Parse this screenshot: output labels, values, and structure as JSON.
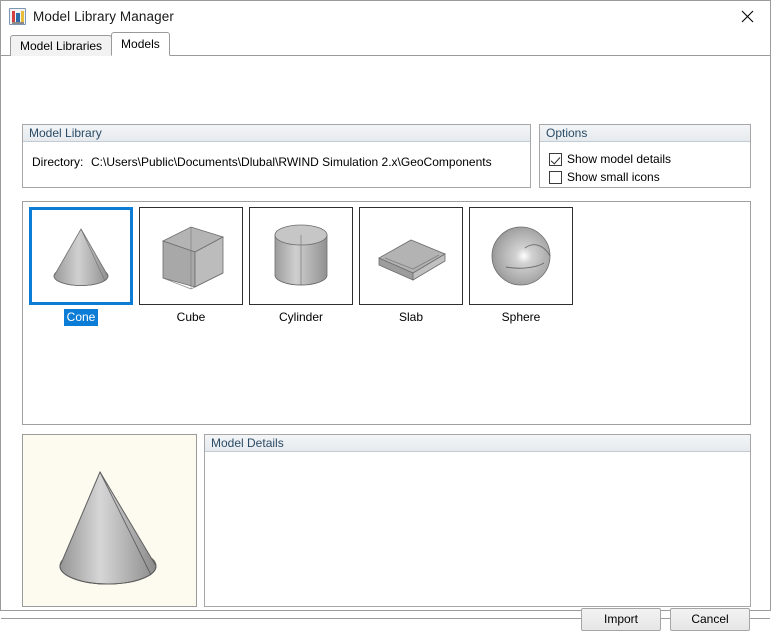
{
  "window": {
    "title": "Model Library Manager",
    "icon": "library-icon",
    "close_label": "✕"
  },
  "tabs": [
    {
      "label": "Model Libraries",
      "active": false
    },
    {
      "label": "Models",
      "active": true
    }
  ],
  "model_library": {
    "group_title": "Model Library",
    "directory_label": "Directory:",
    "directory_value": "C:\\Users\\Public\\Documents\\Dlubal\\RWIND Simulation 2.x\\GeoComponents"
  },
  "options": {
    "group_title": "Options",
    "items": [
      {
        "label": "Show model details",
        "checked": true
      },
      {
        "label": "Show small icons",
        "checked": false
      }
    ]
  },
  "models": [
    {
      "label": "Cone",
      "shape": "cone",
      "selected": true
    },
    {
      "label": "Cube",
      "shape": "cube",
      "selected": false
    },
    {
      "label": "Cylinder",
      "shape": "cylinder",
      "selected": false
    },
    {
      "label": "Slab",
      "shape": "slab",
      "selected": false
    },
    {
      "label": "Sphere",
      "shape": "sphere",
      "selected": false
    }
  ],
  "preview": {
    "shape": "cone",
    "background_color": "#fdfbef"
  },
  "model_details": {
    "group_title": "Model Details",
    "content": ""
  },
  "footer": {
    "import_label": "Import",
    "cancel_label": "Cancel"
  },
  "colors": {
    "selection_blue": "#0c7dd6",
    "group_header_text": "#2a4b66",
    "window_chrome": "#f0f0f0",
    "shape_fill": "#a9a9a9"
  }
}
